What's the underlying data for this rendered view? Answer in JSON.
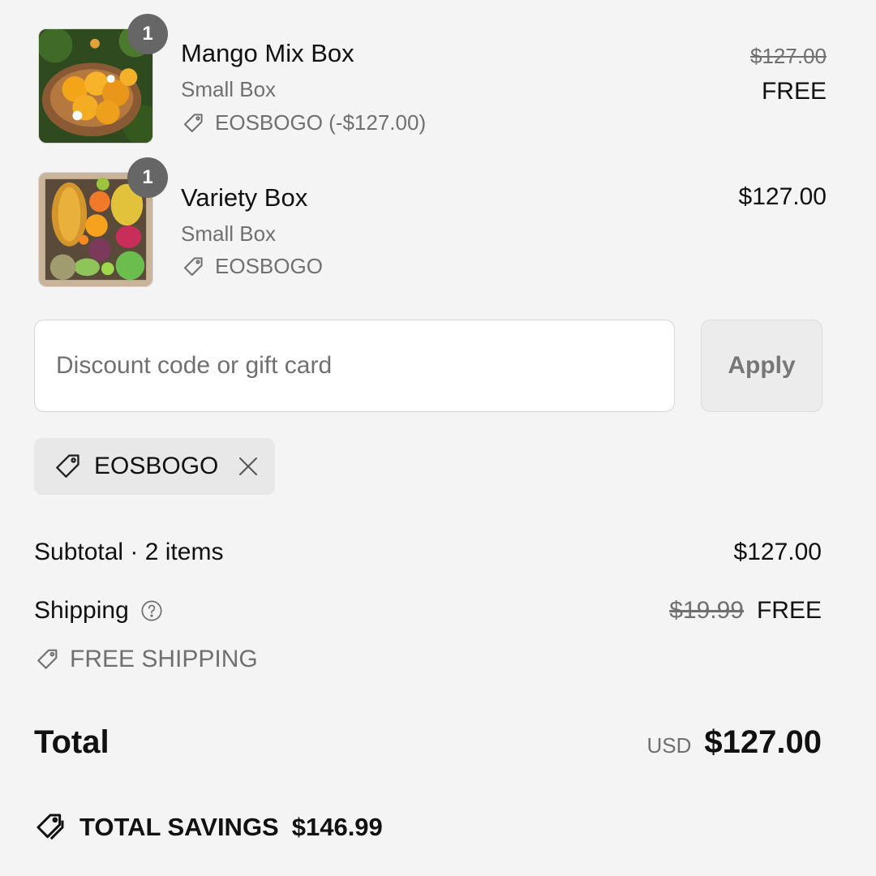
{
  "line_items": [
    {
      "title": "Mango Mix Box",
      "variant": "Small Box",
      "quantity": "1",
      "discount_label": "EOSBOGO (-$127.00)",
      "original_price": "$127.00",
      "price": "FREE",
      "image_icon": "mango-box-photo"
    },
    {
      "title": "Variety Box",
      "variant": "Small Box",
      "quantity": "1",
      "discount_label": "EOSBOGO",
      "price": "$127.00",
      "image_icon": "variety-box-photo"
    }
  ],
  "discount": {
    "placeholder": "Discount code or gift card",
    "apply_label": "Apply",
    "applied_code": "EOSBOGO"
  },
  "summary": {
    "subtotal_label": "Subtotal · 2 items",
    "subtotal_value": "$127.00",
    "shipping_label": "Shipping",
    "shipping_original": "$19.99",
    "shipping_value": "FREE",
    "shipping_discount": "FREE SHIPPING",
    "total_label": "Total",
    "total_currency": "USD",
    "total_value": "$127.00",
    "savings_label": "TOTAL SAVINGS",
    "savings_value": "$146.99"
  },
  "colors": {
    "background": "#f4f4f4",
    "badge": "#666666",
    "muted_text": "#707070",
    "chip_bg": "#e8e8e8"
  }
}
